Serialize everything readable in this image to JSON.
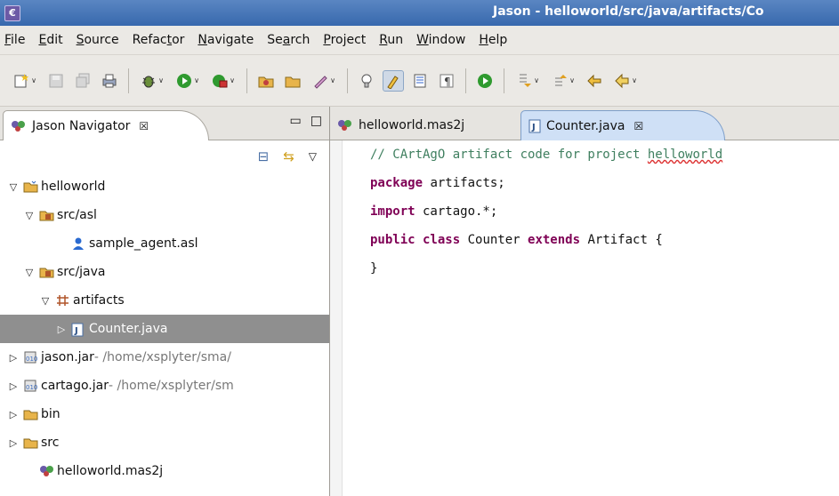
{
  "window": {
    "title": "Jason - helloworld/src/java/artifacts/Co",
    "app_icon_glyph": "€"
  },
  "menu": {
    "items": [
      {
        "first": "F",
        "rest": "ile"
      },
      {
        "first": "E",
        "rest": "dit"
      },
      {
        "first": "S",
        "rest": "ource"
      },
      {
        "pre": "Refac",
        "first": "t",
        "rest": "or"
      },
      {
        "first": "N",
        "rest": "avigate"
      },
      {
        "pre": "Se",
        "first": "a",
        "rest": "rch"
      },
      {
        "first": "P",
        "rest": "roject"
      },
      {
        "first": "R",
        "rest": "un"
      },
      {
        "first": "W",
        "rest": "indow"
      },
      {
        "first": "H",
        "rest": "elp"
      }
    ]
  },
  "navigator": {
    "tab_label": "Jason Navigator",
    "close_glyph": "☒",
    "min_glyph": "▭",
    "max_glyph": "□",
    "collapse_glyph": "⊟",
    "link_glyph": "⇆",
    "menu_glyph": "▽"
  },
  "tree": [
    {
      "label": "helloworld",
      "path": "",
      "twisty": "▽",
      "icon": "project-icon",
      "indent": 0
    },
    {
      "label": "src/asl",
      "path": "",
      "twisty": "▽",
      "icon": "source-folder-icon",
      "indent": 1
    },
    {
      "label": "sample_agent.asl",
      "path": "",
      "twisty": "",
      "icon": "agent-file-icon",
      "indent": 3
    },
    {
      "label": "src/java",
      "path": "",
      "twisty": "▽",
      "icon": "source-folder-icon",
      "indent": 1
    },
    {
      "label": "artifacts",
      "path": "",
      "twisty": "▽",
      "icon": "package-icon",
      "indent": 2
    },
    {
      "label": "Counter.java",
      "path": "",
      "twisty": "▷",
      "icon": "java-file-icon",
      "indent": 3,
      "selected": true
    },
    {
      "label": "jason.jar",
      "path": " - /home/xsplyter/sma/",
      "twisty": "▷",
      "icon": "jar-icon",
      "indent": 0
    },
    {
      "label": "cartago.jar",
      "path": " - /home/xsplyter/sm",
      "twisty": "▷",
      "icon": "jar-icon",
      "indent": 0
    },
    {
      "label": "bin",
      "path": "",
      "twisty": "▷",
      "icon": "folder-icon",
      "indent": 0
    },
    {
      "label": "src",
      "path": "",
      "twisty": "▷",
      "icon": "folder-icon",
      "indent": 0
    },
    {
      "label": "helloworld.mas2j",
      "path": "",
      "twisty": "",
      "icon": "mas2j-file-icon",
      "indent": 1
    }
  ],
  "editor": {
    "tabs": [
      {
        "label": "helloworld.mas2j",
        "active": false
      },
      {
        "label": "Counter.java",
        "active": true
      }
    ],
    "code": {
      "comment_prefix": "// CArtAgO artifact code for project ",
      "comment_project": "helloworld",
      "line_package_kw": "package",
      "line_package_rest": " artifacts;",
      "line_import_kw": "import",
      "line_import_rest": " cartago.*;",
      "line_class_kw1": "public class",
      "line_class_name": " Counter ",
      "line_class_kw2": "extends",
      "line_class_rest": " Artifact {",
      "line_close": "}"
    }
  },
  "colors": {
    "titlebar": "#3768ad",
    "selection": "#8f8f8f",
    "keyword": "#7f0055",
    "comment": "#3f7f5f",
    "active_tab": "#cfe0f6"
  }
}
